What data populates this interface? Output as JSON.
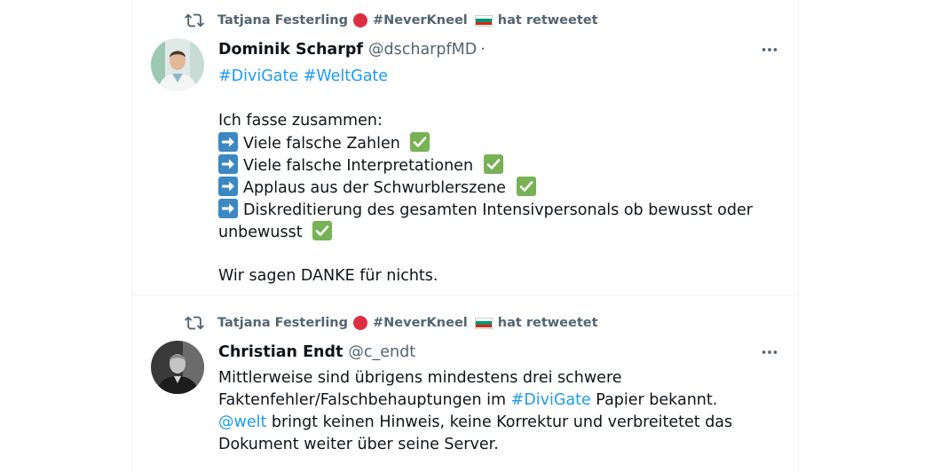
{
  "colors": {
    "link": "#1d9bf0",
    "muted": "#536471",
    "text": "#0f1419",
    "border": "#eff3f4"
  },
  "tweets": [
    {
      "retweet": {
        "user": "Tatjana Festerling",
        "hashtag": "#NeverKneel",
        "suffix": "hat retweetet"
      },
      "name": "Dominik Scharpf",
      "handle": "@dscharpfMD",
      "separator": "·",
      "hashtags": [
        "#DiviGate",
        "#WeltGate"
      ],
      "intro": "Ich fasse zusammen:",
      "bullets": [
        "Viele falsche Zahlen",
        "Viele falsche Interpretationen",
        "Applaus aus der Schwurblerszene",
        "Diskreditierung des gesamten Intensivpersonals ob bewusst oder"
      ],
      "bullet_continuation": "unbewusst",
      "closing": "Wir sagen DANKE für nichts."
    },
    {
      "retweet": {
        "user": "Tatjana Festerling",
        "hashtag": "#NeverKneel",
        "suffix": "hat retweetet"
      },
      "name": "Christian Endt",
      "handle": "@c_endt",
      "line1": "Mittlerweise sind übrigens mindestens drei schwere",
      "line2_pre": "Faktenfehler/Falschbehauptungen im ",
      "line2_tag": "#DiviGate",
      "line2_post": " Papier bekannt.",
      "line3_mention": "@welt",
      "line3_post": " bringt keinen Hinweis, keine Korrektur und verbreitetet das",
      "line4": "Dokument weiter über seine Server."
    }
  ]
}
